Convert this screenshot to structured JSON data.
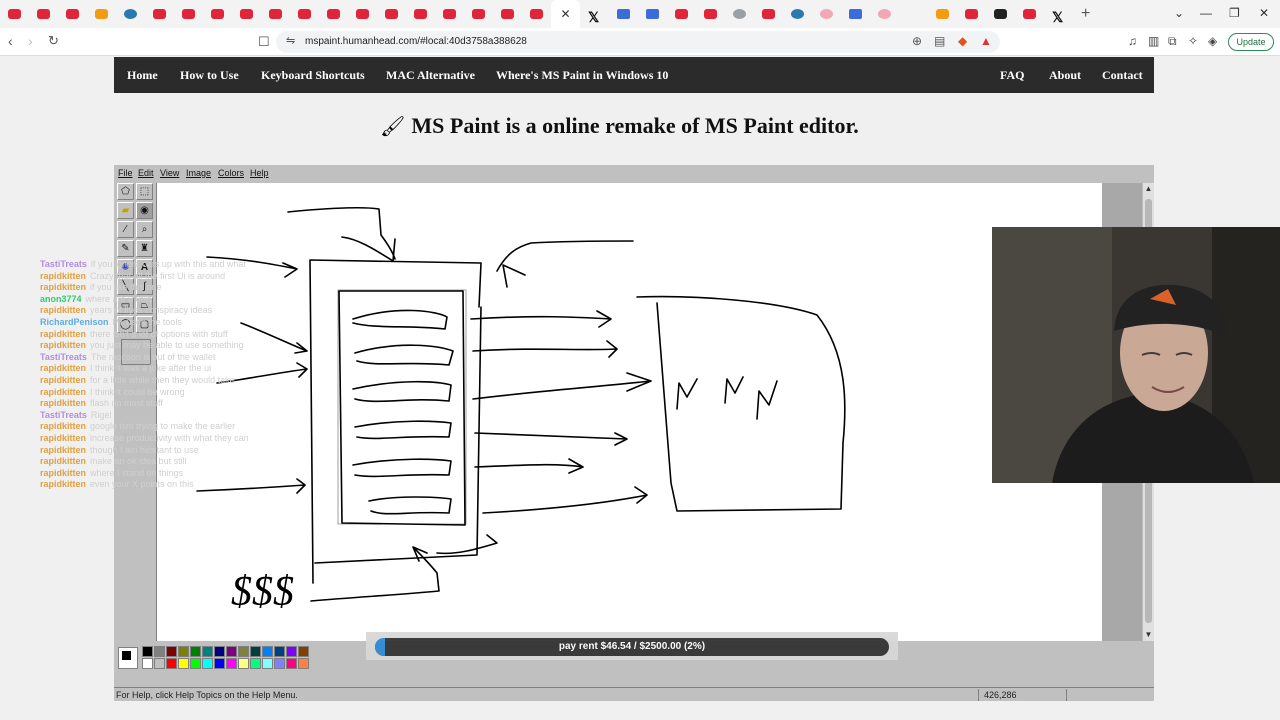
{
  "browser": {
    "url": "mspaint.humanhead.com/#local:40d3758a388628",
    "update_label": "Update",
    "new_tab": "+"
  },
  "site_nav": {
    "left": [
      "Home",
      "How to Use",
      "Keyboard Shortcuts",
      "MAC Alternative",
      "Where's MS Paint in Windows 10"
    ],
    "right": [
      "FAQ",
      "About",
      "Contact"
    ]
  },
  "headline": "MS Paint is a online remake of MS Paint editor.",
  "paint": {
    "menu": [
      "File",
      "Edit",
      "View",
      "Image",
      "Colors",
      "Help"
    ],
    "status_help": "For Help, click Help Topics on the Help Menu.",
    "status_coords": "426,286",
    "palette_top": [
      "#000000",
      "#808080",
      "#800000",
      "#808000",
      "#008000",
      "#008080",
      "#000080",
      "#800080",
      "#808040",
      "#004040",
      "#0080ff",
      "#004080",
      "#8000ff",
      "#804000"
    ],
    "palette_bottom": [
      "#ffffff",
      "#c0c0c0",
      "#ff0000",
      "#ffff00",
      "#00ff00",
      "#00ffff",
      "#0000ff",
      "#ff00ff",
      "#ffff80",
      "#00ff80",
      "#80ffff",
      "#8080ff",
      "#ff0080",
      "#ff8040"
    ],
    "drawing_text": "$$$"
  },
  "donation": {
    "label": "pay rent $46.54 / $2500.00 (2%)",
    "progress_percent": 2
  },
  "chat": [
    {
      "user": "TastiTreats",
      "text": "if you ignore cars up with this and what",
      "color": "#b48ee0"
    },
    {
      "user": "rapidkitten",
      "text": "Crazy that all the first Ui is around",
      "color": "#e0a040"
    },
    {
      "user": "rapidkitten",
      "text": "if you like this one",
      "color": "#e0a040"
    },
    {
      "user": "anon3774",
      "text": "where are u utils",
      "color": "#2ecc71"
    },
    {
      "user": "rapidkitten",
      "text": "years of llyes conspiracy ideas",
      "color": "#e0a040"
    },
    {
      "user": "RichardPenison",
      "text": "PT uses the tools",
      "color": "#5dade2"
    },
    {
      "user": "rapidkitten",
      "text": "there isn't a lot of options with stuff",
      "color": "#e0a040"
    },
    {
      "user": "rapidkitten",
      "text": "you just may be able to use something",
      "color": "#e0a040"
    },
    {
      "user": "TastiTreats",
      "text": "The raccoon is out of the wallet",
      "color": "#b48ee0"
    },
    {
      "user": "rapidkitten",
      "text": "I think it was a joke after the ui",
      "color": "#e0a040"
    },
    {
      "user": "rapidkitten",
      "text": "for a little while then they would take",
      "color": "#e0a040"
    },
    {
      "user": "rapidkitten",
      "text": "I think it could be wrong",
      "color": "#e0a040"
    },
    {
      "user": "rapidkitten",
      "text": "flash on most stuff",
      "color": "#e0a040"
    },
    {
      "user": "TastiTreats",
      "text": "Rigel",
      "color": "#b48ee0"
    },
    {
      "user": "rapidkitten",
      "text": "google isnt trying to make the earlier",
      "color": "#e0a040"
    },
    {
      "user": "rapidkitten",
      "text": "increase productivity with what they can",
      "color": "#e0a040"
    },
    {
      "user": "rapidkitten",
      "text": "though I am hesitant to use",
      "color": "#e0a040"
    },
    {
      "user": "rapidkitten",
      "text": "make an ok idea but still",
      "color": "#e0a040"
    },
    {
      "user": "rapidkitten",
      "text": "where I stand on things",
      "color": "#e0a040"
    },
    {
      "user": "rapidkitten",
      "text": "even your X points on this",
      "color": "#e0a040"
    }
  ],
  "colors": {
    "nav_bg": "#2b2b2b",
    "app_gray": "#c0c0c0",
    "progress": "#2e8bd6"
  }
}
